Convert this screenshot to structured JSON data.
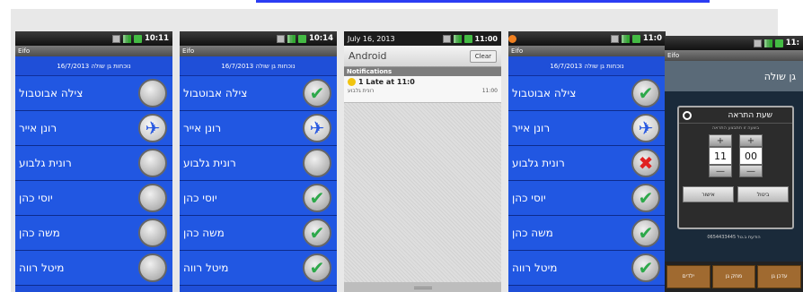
{
  "screens": {
    "s1": {
      "time": "10:11",
      "app": "Eifo",
      "subtitle": "נוכחות גן שולה 16/7/2013",
      "rows": [
        {
          "name": "צילה אבוטבול",
          "state": "empty"
        },
        {
          "name": "רונן אייר",
          "state": "plane"
        },
        {
          "name": "רונית גלבוע",
          "state": "empty"
        },
        {
          "name": "יוסי כהן",
          "state": "empty"
        },
        {
          "name": "משה כהן",
          "state": "empty"
        },
        {
          "name": "מיטל רווה",
          "state": "empty"
        }
      ]
    },
    "s2": {
      "time": "10:14",
      "app": "Eifo",
      "subtitle": "נוכחות גן שולה 16/7/2013",
      "rows": [
        {
          "name": "צילה אבוטבול",
          "state": "check"
        },
        {
          "name": "רונן אייר",
          "state": "plane"
        },
        {
          "name": "רונית גלבוע",
          "state": "empty"
        },
        {
          "name": "יוסי כהן",
          "state": "check"
        },
        {
          "name": "משה כהן",
          "state": "check"
        },
        {
          "name": "מיטל רווה",
          "state": "check"
        }
      ]
    },
    "s3": {
      "date": "July 16, 2013",
      "time": "11:00",
      "carrier": "Android",
      "clear": "Clear",
      "section": "Notifications",
      "item_title": "1 Late at 11:0",
      "item_sub": "רונית גלבוע",
      "item_time": "11:00"
    },
    "s4": {
      "time": "11:0",
      "app": "Eifo",
      "subtitle": "נוכחות גן שולה 16/7/2013",
      "rows": [
        {
          "name": "צילה אבוטבול",
          "state": "check"
        },
        {
          "name": "רונן אייר",
          "state": "plane"
        },
        {
          "name": "רונית גלבוע",
          "state": "x"
        },
        {
          "name": "יוסי כהן",
          "state": "check"
        },
        {
          "name": "משה כהן",
          "state": "check"
        },
        {
          "name": "מיטל רווה",
          "state": "check"
        }
      ]
    },
    "s5": {
      "time": "11:",
      "app": "Eifo",
      "header": "גן שולה",
      "dialog_title": "שעת התראה",
      "dialog_sub": "בשעה זו תתבצע התראה",
      "hour": "11",
      "minute": "00",
      "plus": "+",
      "minus": "—",
      "btn_ok": "אישור",
      "btn_cancel": "ביטול",
      "note": "הודעת ב.טל 0654433445",
      "tabs": [
        "ילדים",
        "מחק גן",
        "עדכן גן"
      ]
    }
  }
}
